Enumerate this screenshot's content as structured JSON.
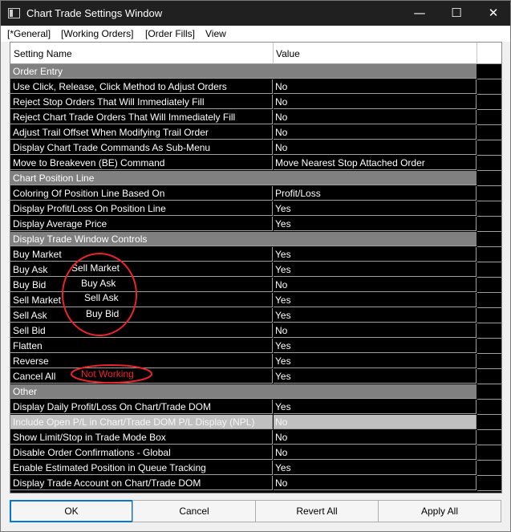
{
  "window": {
    "title": "Chart Trade Settings Window",
    "minimize": "—",
    "maximize": "☐",
    "close": "✕"
  },
  "menu": [
    "[*General]",
    "[Working Orders]",
    "[Order Fills]",
    "View"
  ],
  "grid": {
    "col_name": "Setting Name",
    "col_value": "Value",
    "rows": [
      {
        "type": "category",
        "name": "Order Entry"
      },
      {
        "type": "setting",
        "name": "Use Click, Release, Click Method to Adjust Orders",
        "value": "No"
      },
      {
        "type": "setting",
        "name": "Reject Stop Orders That Will Immediately Fill",
        "value": "No"
      },
      {
        "type": "setting",
        "name": "Reject Chart Trade Orders That Will Immediately Fill",
        "value": "No"
      },
      {
        "type": "setting",
        "name": "Adjust Trail Offset When Modifying Trail Order",
        "value": "No"
      },
      {
        "type": "setting",
        "name": "Display Chart Trade Commands As Sub-Menu",
        "value": "No"
      },
      {
        "type": "setting",
        "name": "Move to Breakeven (BE) Command",
        "value": "Move Nearest Stop Attached Order"
      },
      {
        "type": "category",
        "name": "Chart Position Line"
      },
      {
        "type": "setting",
        "name": "Coloring Of Position Line Based On",
        "value": "Profit/Loss"
      },
      {
        "type": "setting",
        "name": "Display Profit/Loss On Position Line",
        "value": "Yes"
      },
      {
        "type": "setting",
        "name": "Display Average Price",
        "value": "Yes"
      },
      {
        "type": "category",
        "name": "Display Trade Window Controls"
      },
      {
        "type": "setting",
        "name": "Buy Market",
        "value": "Yes"
      },
      {
        "type": "setting",
        "name": "Buy Ask",
        "value": "Yes"
      },
      {
        "type": "setting",
        "name": "Buy Bid",
        "value": "No"
      },
      {
        "type": "setting",
        "name": "Sell Market",
        "value": "Yes"
      },
      {
        "type": "setting",
        "name": "Sell Ask",
        "value": "Yes"
      },
      {
        "type": "setting",
        "name": "Sell Bid",
        "value": "No"
      },
      {
        "type": "setting",
        "name": "Flatten",
        "value": "Yes"
      },
      {
        "type": "setting",
        "name": "Reverse",
        "value": "Yes"
      },
      {
        "type": "setting",
        "name": "Cancel All",
        "value": "Yes"
      },
      {
        "type": "category",
        "name": "Other"
      },
      {
        "type": "setting",
        "name": "Display Daily Profit/Loss On Chart/Trade DOM",
        "value": "Yes"
      },
      {
        "type": "disabled",
        "name": "Include Open P/L in Chart/Trade DOM P/L Display (NPL)",
        "value": "No"
      },
      {
        "type": "setting",
        "name": "Show Limit/Stop in Trade Mode Box",
        "value": "No"
      },
      {
        "type": "setting",
        "name": "Disable Order Confirmations - Global",
        "value": "No"
      },
      {
        "type": "setting",
        "name": "Enable Estimated Position in Queue Tracking",
        "value": "Yes"
      },
      {
        "type": "setting",
        "name": "Display Trade Account on Chart/Trade DOM",
        "value": "No"
      }
    ]
  },
  "annotations": {
    "sell_market": "Sell Market",
    "buy_ask": "Buy Ask",
    "sell_ask": "Sell Ask",
    "buy_bid": "Buy Bid",
    "not_working": "Not Working",
    "ink_color": "#e8242a"
  },
  "buttons": {
    "ok": "OK",
    "cancel": "Cancel",
    "revert_all": "Revert All",
    "apply_all": "Apply All"
  }
}
